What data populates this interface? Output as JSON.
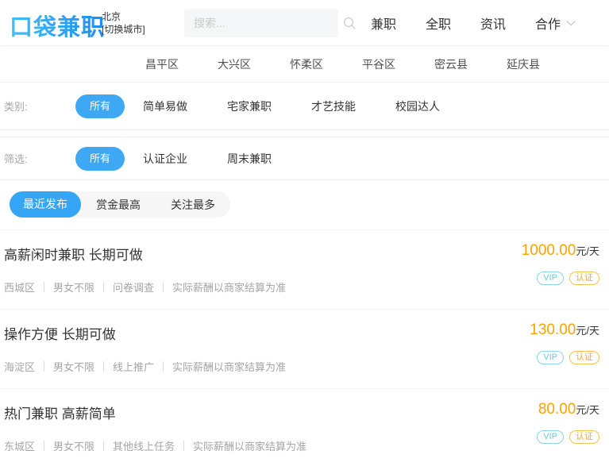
{
  "header": {
    "logo": "口袋兼职",
    "city": "北京",
    "city_switch": "[切换城市]",
    "search_placeholder": "搜索...",
    "nav": [
      {
        "label": "兼职"
      },
      {
        "label": "全职"
      },
      {
        "label": "资讯"
      },
      {
        "label": "合作",
        "has_dropdown": true
      }
    ]
  },
  "districts": [
    "昌平区",
    "大兴区",
    "怀柔区",
    "平谷区",
    "密云县",
    "延庆县"
  ],
  "category_filter": {
    "label": "类别:",
    "selected": "所有",
    "options": [
      "简单易做",
      "宅家兼职",
      "才艺技能",
      "校园达人"
    ]
  },
  "screen_filter": {
    "label": "筛选:",
    "selected": "所有",
    "options": [
      "认证企业",
      "周末兼职"
    ]
  },
  "sort_tabs": {
    "selected": "最近发布",
    "others": [
      "赏金最高",
      "关注最多"
    ]
  },
  "jobs": [
    {
      "title": "高薪闲时兼职 长期可做",
      "price": "1000.00",
      "price_unit": "元/天",
      "meta": [
        "西城区",
        "男女不限",
        "问卷调查",
        "实际薪酬以商家结算为准"
      ],
      "badges": {
        "vip": "VIP",
        "verified": "认证"
      }
    },
    {
      "title": "操作方便 长期可做",
      "price": "130.00",
      "price_unit": "元/天",
      "meta": [
        "海淀区",
        "男女不限",
        "线上推广",
        "实际薪酬以商家结算为准"
      ],
      "badges": {
        "vip": "VIP",
        "verified": "认证"
      }
    },
    {
      "title": "热门兼职 高薪简单",
      "price": "80.00",
      "price_unit": "元/天",
      "meta": [
        "东城区",
        "男女不限",
        "其他线上任务",
        "实际薪酬以商家结算为准"
      ],
      "badges": {
        "vip": "VIP",
        "verified": "认证"
      }
    }
  ],
  "colors": {
    "accent_blue": "#3ea8f5",
    "logo_blue_gradient_start": "#3fc0f8",
    "logo_blue_gradient_end": "#1e8bf2",
    "price_orange": "#ffa200",
    "vip_badge": "#6cc8df",
    "verified_badge": "#f0a93c",
    "meta_gray": "#a5a5a5"
  }
}
